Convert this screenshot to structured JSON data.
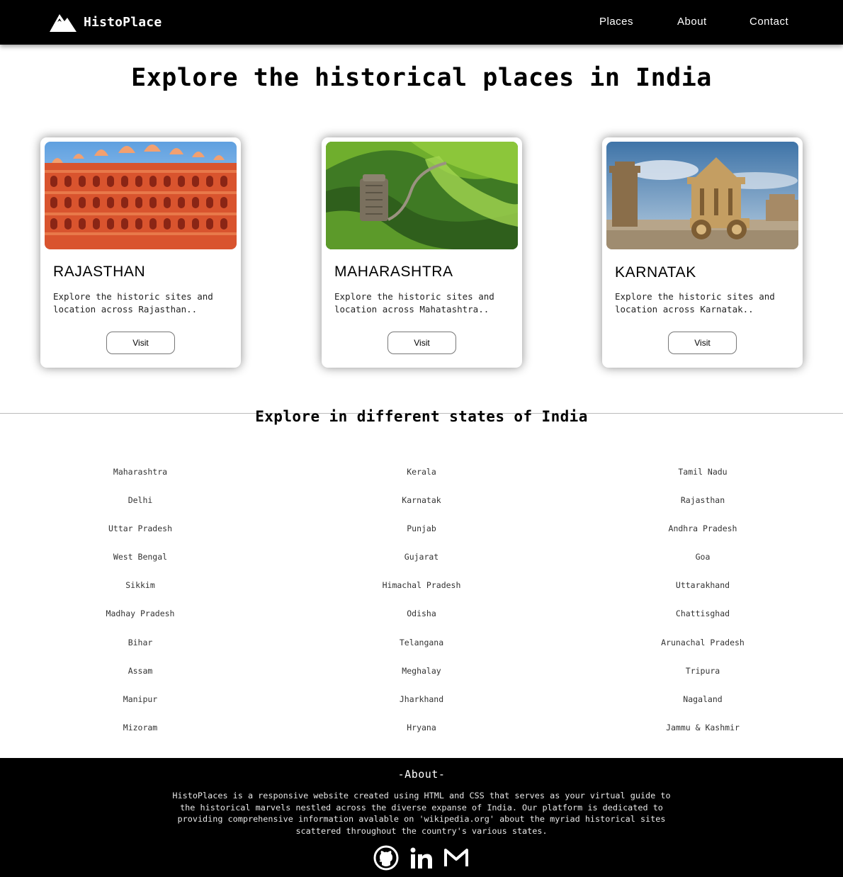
{
  "header": {
    "brand": "HistoPlace",
    "logo_icon": "mountain-icon",
    "nav": [
      "Places",
      "About",
      "Contact"
    ]
  },
  "main": {
    "title": "Explore the historical places in India",
    "cards": [
      {
        "title": "RAJASTHAN",
        "description": "Explore the historic sites and location across Rajasthan..",
        "button": "Visit"
      },
      {
        "title": "MAHARASHTRA",
        "description": "Explore the historic sites and location across Mahatashtra..",
        "button": "Visit"
      },
      {
        "title": "KARNATAK",
        "description": "Explore the historic sites and location across Karnatak..",
        "button": "Visit"
      }
    ]
  },
  "states": {
    "title": "Explore in different states of India",
    "columns": [
      [
        "Maharashtra",
        "Delhi",
        "Uttar Pradesh",
        "West Bengal",
        "Sikkim",
        "Madhay Pradesh",
        "Bihar",
        "Assam",
        "Manipur",
        "Mizoram"
      ],
      [
        "Kerala",
        "Karnatak",
        "Punjab",
        "Gujarat",
        "Himachal Pradesh",
        "Odisha",
        "Telangana",
        "Meghalay",
        "Jharkhand",
        "Hryana"
      ],
      [
        "Tamil Nadu",
        "Rajasthan",
        "Andhra Pradesh",
        "Goa",
        "Uttarakhand",
        "Chattisghad",
        "Arunachal Pradesh",
        "Tripura",
        "Nagaland",
        "Jammu & Kashmir"
      ]
    ]
  },
  "footer": {
    "title": "-About-",
    "text": "HistoPlaces is a responsive website created using HTML and CSS that serves as your virtual guide to the historical marvels nestled across the diverse expanse of India. Our platform is dedicated to providing comprehensive information avalable on 'wikipedia.org' about the myriad historical sites scattered throughout the country's various states.",
    "social_icons": [
      "github-icon",
      "linkedin-icon",
      "gmail-icon"
    ]
  }
}
